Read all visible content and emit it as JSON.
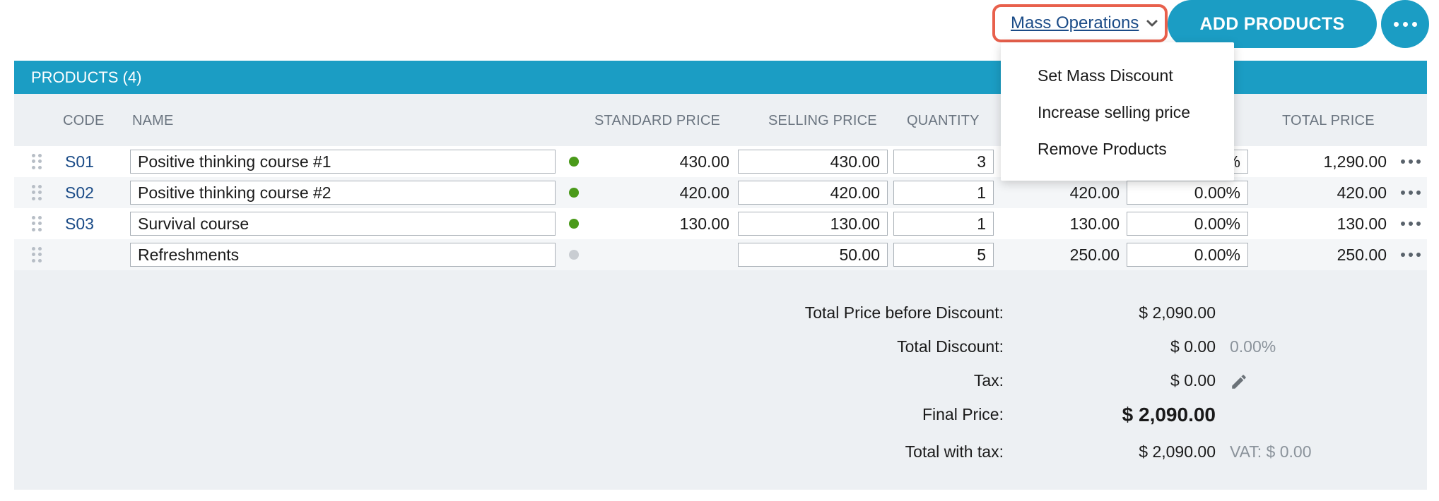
{
  "toolbar": {
    "mass_operations_label": "Mass Operations",
    "add_products_label": "ADD PRODUCTS"
  },
  "panel": {
    "title": "PRODUCTS (4)"
  },
  "columns": {
    "code": "CODE",
    "name": "NAME",
    "standard_price": "STANDARD PRICE",
    "selling_price": "SELLING PRICE",
    "quantity": "QUANTITY",
    "total_price": "TOTAL PRICE"
  },
  "rows": [
    {
      "code": "S01",
      "name": "Positive thinking course #1",
      "status": "active",
      "standard_price": "430.00",
      "selling_price": "430.00",
      "quantity": "3",
      "amount": "",
      "discount": "%",
      "total_price": "1,290.00"
    },
    {
      "code": "S02",
      "name": "Positive thinking course #2",
      "status": "active",
      "standard_price": "420.00",
      "selling_price": "420.00",
      "quantity": "1",
      "amount": "420.00",
      "discount": "0.00%",
      "total_price": "420.00"
    },
    {
      "code": "S03",
      "name": "Survival course",
      "status": "active",
      "standard_price": "130.00",
      "selling_price": "130.00",
      "quantity": "1",
      "amount": "130.00",
      "discount": "0.00%",
      "total_price": "130.00"
    },
    {
      "code": "",
      "name": "Refreshments",
      "status": "inactive",
      "standard_price": "",
      "selling_price": "50.00",
      "quantity": "5",
      "amount": "250.00",
      "discount": "0.00%",
      "total_price": "250.00"
    }
  ],
  "status_colors": {
    "active": "#4a9a1a",
    "inactive": "#c9cdd2"
  },
  "totals": {
    "before_discount_label": "Total Price before Discount:",
    "before_discount_value": "$ 2,090.00",
    "discount_label": "Total Discount:",
    "discount_value": "$ 0.00",
    "discount_percent": "0.00%",
    "tax_label": "Tax:",
    "tax_value": "$ 0.00",
    "final_label": "Final Price:",
    "final_value": "$ 2,090.00",
    "with_tax_label": "Total with tax:",
    "with_tax_value": "$ 2,090.00",
    "vat_note": "VAT: $ 0.00"
  },
  "mass_menu": {
    "items": [
      "Set Mass Discount",
      "Increase selling price",
      "Remove Products"
    ]
  },
  "icons": {
    "chevron": "chevron-down-icon",
    "more": "more-horizontal-icon",
    "drag": "drag-handle-icon",
    "edit": "pencil-icon"
  },
  "colors": {
    "accent": "#1b9dc4",
    "highlight_border": "#e8604c",
    "link": "#1a4b87"
  }
}
